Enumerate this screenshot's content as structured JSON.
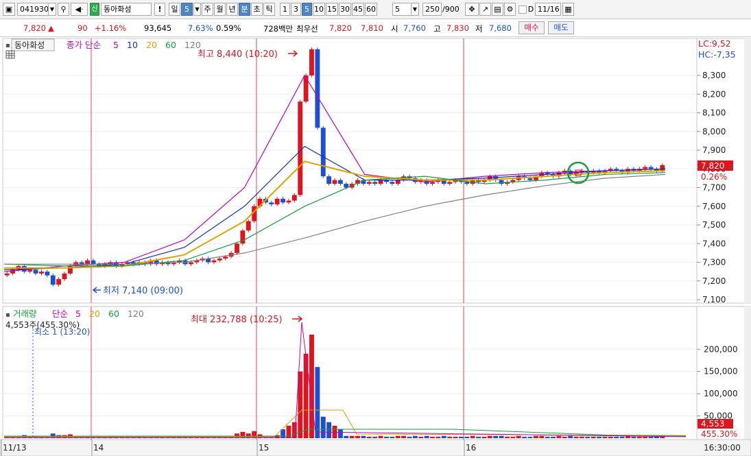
{
  "toolbar": {
    "code": "041930",
    "badge": "신",
    "name": "동아화성",
    "alert": "!",
    "periods": [
      {
        "label": "일",
        "active": false
      },
      {
        "label": "5",
        "active": true
      },
      {
        "label": "주",
        "active": false
      },
      {
        "label": "월",
        "active": false
      },
      {
        "label": "년",
        "active": false
      },
      {
        "label": "분",
        "active": true
      },
      {
        "label": "초",
        "active": false
      },
      {
        "label": "틱",
        "active": false
      }
    ],
    "intervals": [
      {
        "label": "1",
        "active": false
      },
      {
        "label": "3",
        "active": false
      },
      {
        "label": "5",
        "active": true
      },
      {
        "label": "10",
        "active": false
      },
      {
        "label": "15",
        "active": false
      },
      {
        "label": "30",
        "active": false
      },
      {
        "label": "45",
        "active": false
      },
      {
        "label": "60",
        "active": false
      }
    ],
    "interval_value": "5",
    "count_value": "250",
    "count_total": "/900",
    "d_label": "D",
    "date": "11/16"
  },
  "quote": {
    "price": "7,820",
    "arrow": "▲",
    "change": "90",
    "change_pct": "+1.16%",
    "volume": "93,645",
    "turnover_pct": "7.63%",
    "ratio": "0.59%",
    "amount": "728백만",
    "ask_label": "최우선",
    "ask": "7,820",
    "bid": "7,810",
    "open_label": "시",
    "open": "7,760",
    "high_label": "고",
    "high": "7,830",
    "low_label": "저",
    "low": "7,680",
    "buy_label": "매수",
    "sell_label": "매도"
  },
  "price_panel": {
    "name": "동아화성",
    "ma_title": "종가 단순",
    "ma_periods": [
      "5",
      "10",
      "20",
      "60",
      "120"
    ],
    "ma_colors": [
      "#c000c0",
      "#1030c0",
      "#e0a000",
      "#10a040",
      "#808080"
    ],
    "lc": "LC:9,52",
    "hc": "HC:-7,35",
    "high_note": "최고 8,440 (10:20)",
    "low_note": "최저 7,140 (09:00)",
    "y_ticks": [
      "8,300",
      "8,200",
      "8,100",
      "8,000",
      "7,900",
      "7,800",
      "7,700",
      "7,600",
      "7,500",
      "7,400",
      "7,300",
      "7,200",
      "7,100"
    ],
    "current_price_label": "7,820",
    "current_pct_label": "0.26%"
  },
  "volume_panel": {
    "title": "거래량",
    "ma_title": "단순",
    "ma_periods": [
      "5",
      "20",
      "60",
      "120"
    ],
    "ma_colors": [
      "#c000c0",
      "#e0a000",
      "#10a040",
      "#808080"
    ],
    "current_text": "4,553주(455.30%)",
    "min_note": "최소 1 (13:20)",
    "max_note": "최대 232,788 (10:25)",
    "y_ticks": [
      "200,000",
      "150,000",
      "100,000",
      "50,000"
    ],
    "current_label": "4,553",
    "current_pct": "455.30%"
  },
  "x_axis": {
    "labels": [
      "11/13",
      "14",
      "15",
      "16"
    ],
    "time": "16:30:00"
  },
  "colors": {
    "up": "#e0141e",
    "down": "#1f4fd0",
    "grid": "#e6e6e6",
    "divider": "#e0141e",
    "highlight_circle": "#1aa032"
  },
  "chart_data": {
    "type": "candlestick",
    "y_unit": "KRW",
    "y_range": [
      7100,
      8440
    ],
    "volume_range": [
      0,
      232788
    ],
    "days": [
      "11/13",
      "14",
      "15",
      "16"
    ],
    "series": [
      {
        "name": "5",
        "values": [
          7250,
          7280,
          7300,
          7420,
          7700,
          8300,
          7770,
          7730,
          7760,
          7780,
          7790,
          7800
        ]
      },
      {
        "name": "10",
        "values": [
          7260,
          7270,
          7290,
          7380,
          7600,
          7920,
          7740,
          7740,
          7750,
          7770,
          7790,
          7800
        ]
      },
      {
        "name": "20",
        "values": [
          7270,
          7270,
          7280,
          7340,
          7520,
          7840,
          7760,
          7740,
          7740,
          7760,
          7780,
          7790
        ]
      },
      {
        "name": "60",
        "values": [
          7290,
          7280,
          7280,
          7310,
          7420,
          7600,
          7740,
          7760,
          7720,
          7740,
          7770,
          7780
        ]
      },
      {
        "name": "120",
        "values": [
          7290,
          7290,
          7290,
          7300,
          7350,
          7430,
          7520,
          7600,
          7660,
          7710,
          7750,
          7770
        ]
      }
    ],
    "candles": [
      7240,
      7260,
      7280,
      7250,
      7260,
      7240,
      7250,
      7230,
      7180,
      7210,
      7240,
      7280,
      7300,
      7290,
      7310,
      7290,
      7280,
      7290,
      7300,
      7280,
      7290,
      7300,
      7290,
      7300,
      7290,
      7310,
      7290,
      7300,
      7290,
      7300,
      7310,
      7290,
      7300,
      7310,
      7320,
      7300,
      7310,
      7320,
      7330,
      7350,
      7400,
      7470,
      7520,
      7600,
      7640,
      7620,
      7610,
      7640,
      7620,
      7630,
      7660,
      8160,
      8300,
      8440,
      8020,
      7760,
      7720,
      7740,
      7720,
      7700,
      7720,
      7740,
      7720,
      7730,
      7720,
      7740,
      7730,
      7720,
      7740,
      7760,
      7750,
      7730,
      7740,
      7720,
      7730,
      7740,
      7720,
      7730,
      7740,
      7730,
      7720,
      7740,
      7730,
      7740,
      7760,
      7740,
      7720,
      7730,
      7740,
      7760,
      7750,
      7740,
      7760,
      7780,
      7770,
      7760,
      7780,
      7790,
      7770,
      7780,
      7790,
      7780,
      7790,
      7780,
      7790,
      7800,
      7790,
      7780,
      7800,
      7790,
      7800,
      7810,
      7800,
      7790,
      7820
    ]
  }
}
